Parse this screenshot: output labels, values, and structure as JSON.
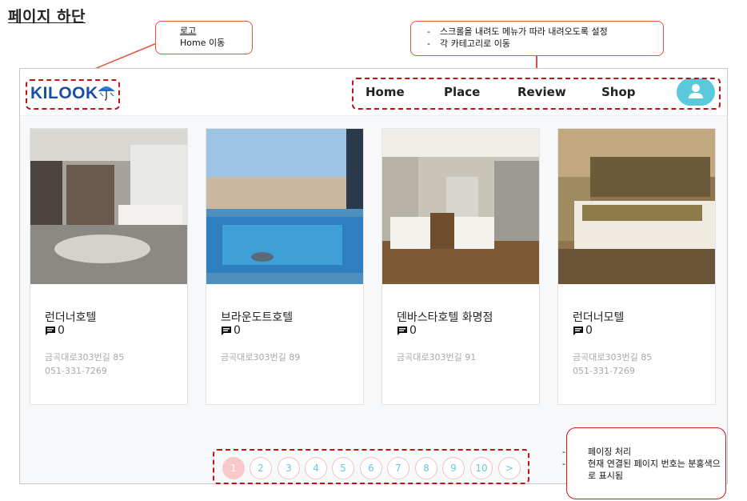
{
  "page_title": "페이지 하단",
  "annotations": {
    "logo_note": {
      "line1": "로고",
      "line2": "Home 이동"
    },
    "menu_note": {
      "items": [
        "스크롤을 내려도 메뉴가 따라 내려오도록 설정",
        "각 카테고리로 이동"
      ]
    },
    "pagination_note": {
      "items": [
        "페이징 처리",
        "현재 연결된 페이지 번호는 분홍색으로 표시됨"
      ]
    }
  },
  "header": {
    "logo_text": "KILOOK",
    "nav": [
      "Home",
      "Place",
      "Review",
      "Shop"
    ],
    "avatar_icon": "user-icon"
  },
  "cards": [
    {
      "name": "런더너호텔",
      "review_count": "0",
      "address": "금곡대로303번길 85",
      "phone": "051-331-7269"
    },
    {
      "name": "브라운도트호텔",
      "review_count": "0",
      "address": "금곡대로303번길 89",
      "phone": ""
    },
    {
      "name": "덴바스타호텔 화명점",
      "review_count": "0",
      "address": "금곡대로303번길 91",
      "phone": ""
    },
    {
      "name": "런더너모텔",
      "review_count": "0",
      "address": "금곡대로303번길 85",
      "phone": "051-331-7269"
    }
  ],
  "pagination": {
    "pages": [
      "1",
      "2",
      "3",
      "4",
      "5",
      "6",
      "7",
      "8",
      "9",
      "10"
    ],
    "next": ">",
    "current": "1"
  },
  "colors": {
    "accent_pink": "#f9c8c8",
    "page_number": "#6cc6e0",
    "annotation_red": "#d01818",
    "logo_blue": "#1a4ea8",
    "avatar_bg": "#5ac9dc"
  }
}
